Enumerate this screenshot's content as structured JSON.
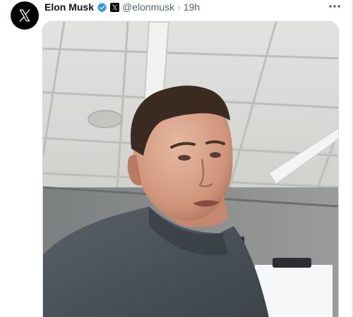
{
  "tweet": {
    "author_name": "Elon Musk",
    "handle": "@elonmusk",
    "separator": "·",
    "time": "19h",
    "avatar_icon": "x-logo-icon",
    "verified_icon": "verified-badge-icon",
    "affiliate_icon": "x-affiliate-badge-icon",
    "more_icon": "more-options-icon",
    "media_type": "video"
  },
  "colors": {
    "verified_blue": "#1d9bf0",
    "name_text": "#0f1419",
    "secondary_text": "#536471"
  }
}
